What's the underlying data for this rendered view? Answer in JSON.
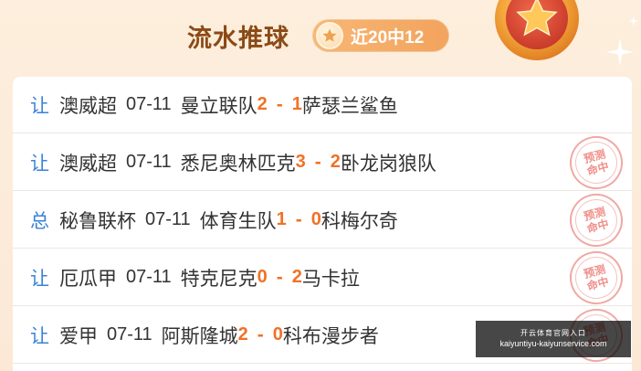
{
  "header": {
    "title": "流水推球",
    "record": "近20中12",
    "medal_icon": "medal-star-icon",
    "record_icon": "star-icon"
  },
  "matches": [
    {
      "tag": "让",
      "league": "澳威超",
      "date": "07-11",
      "home": "曼立联队",
      "home_score": "2",
      "away_score": "1",
      "away": "萨瑟兰鲨鱼",
      "stamp": false
    },
    {
      "tag": "让",
      "league": "澳威超",
      "date": "07-11",
      "home": "悉尼奥林匹克",
      "home_score": "3",
      "away_score": "2",
      "away": "卧龙岗狼队",
      "stamp": true
    },
    {
      "tag": "总",
      "league": "秘鲁联杯",
      "date": "07-11",
      "home": "体育生队",
      "home_score": "1",
      "away_score": "0",
      "away": "科梅尔奇",
      "stamp": true
    },
    {
      "tag": "让",
      "league": "厄瓜甲",
      "date": "07-11",
      "home": "特克尼克",
      "home_score": "0",
      "away_score": "2",
      "away": "马卡拉",
      "stamp": true
    },
    {
      "tag": "让",
      "league": "爱甲",
      "date": "07-11",
      "home": "阿斯隆城",
      "home_score": "2",
      "away_score": "0",
      "away": "科布漫步者",
      "stamp": true
    }
  ],
  "score_separator": "-",
  "stamp_text": {
    "line1": "预测",
    "line2": "命中"
  },
  "watermark": {
    "line1": "开云体育官网入口",
    "line2": "kaiyuntiyu-kaiyunservice.com"
  },
  "colors": {
    "tag": "#3a82d6",
    "score": "#f07226",
    "title": "#8b4a16",
    "pill": "#f3a35d",
    "stamp": "#f08f89"
  }
}
